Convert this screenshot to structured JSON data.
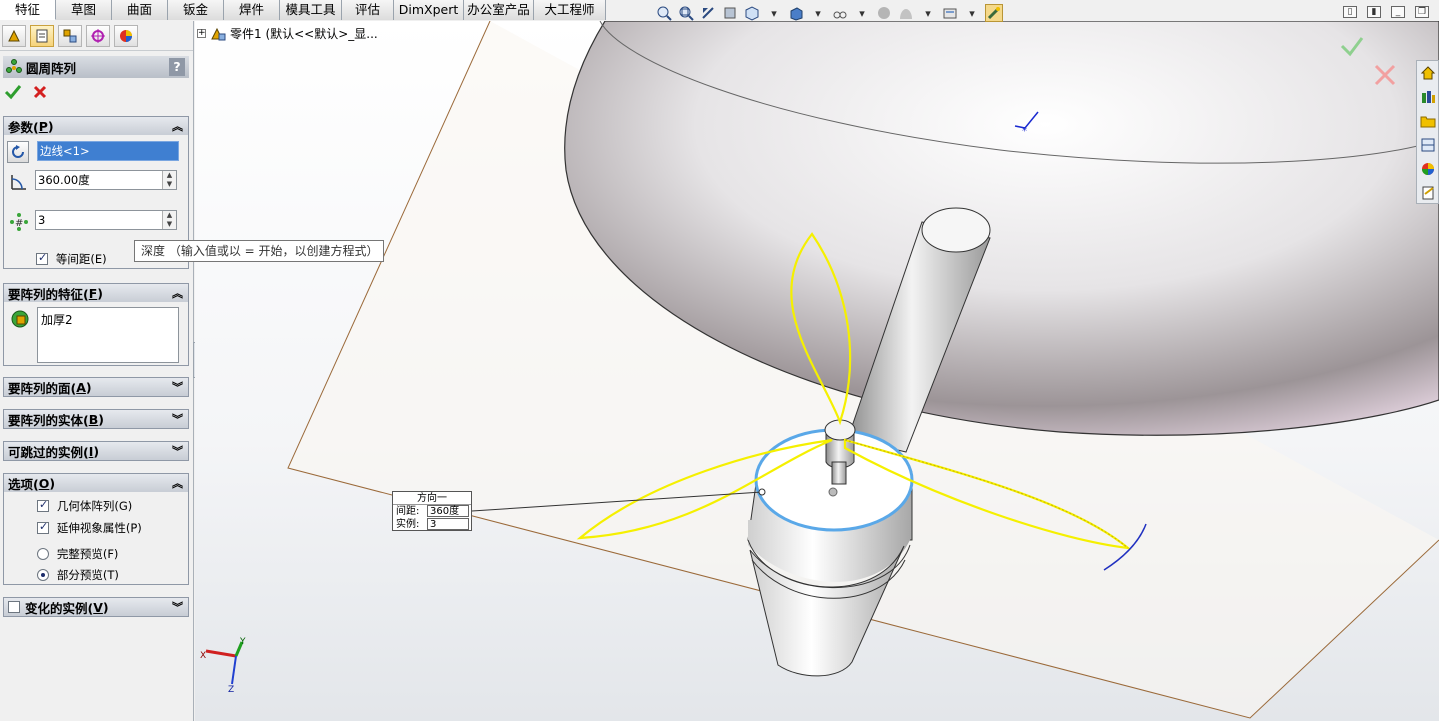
{
  "tabs": [
    {
      "label": "特征",
      "active": true
    },
    {
      "label": "草图"
    },
    {
      "label": "曲面"
    },
    {
      "label": "钣金"
    },
    {
      "label": "焊件"
    },
    {
      "label": "模具工具"
    },
    {
      "label": "评估"
    },
    {
      "label": "DimXpert"
    },
    {
      "label": "办公室产品"
    },
    {
      "label": "大工程师"
    }
  ],
  "panel": {
    "feature_title": "圆周阵列",
    "help": "?",
    "params": {
      "head": "参数(",
      "head_key": "P",
      "head_end": ")",
      "axis_value": "边线<1>",
      "angle_value": "360.00度",
      "count_value": "3",
      "equal_spacing_label": "等间距(E)"
    },
    "features": {
      "head": "要阵列的特征(",
      "head_key": "F",
      "head_end": ")",
      "item": "加厚2"
    },
    "faces": {
      "head": "要阵列的面(",
      "head_key": "A",
      "head_end": ")"
    },
    "bodies": {
      "head": "要阵列的实体(",
      "head_key": "B",
      "head_end": ")"
    },
    "skip": {
      "head": "可跳过的实例(",
      "head_key": "I",
      "head_end": ")"
    },
    "options": {
      "head": "选项(",
      "head_key": "O",
      "head_end": ")",
      "geometry_pattern": "几何体阵列(G)",
      "propagate": "延伸视象属性(P)",
      "full_preview": "完整预览(F)",
      "partial_preview": "部分预览(T)"
    },
    "vary": {
      "head": "变化的实例(",
      "head_key": "V",
      "head_end": ")"
    }
  },
  "tooltip": "深度 （输入值或以 = 开始，以创建方程式）",
  "tree": {
    "label": "零件1 (默认<<默认>_显..."
  },
  "dimension_callout": {
    "title": "方向一",
    "spacing_label": "间距:",
    "spacing_value": "360度",
    "instances_label": "实例:",
    "instances_value": "3"
  },
  "triad": {
    "x": "X",
    "y": "Y",
    "z": "Z"
  },
  "colors": {
    "preview": "#f5f000",
    "selection": "#5aa8e8",
    "accept": "#2e9e2e",
    "cancel": "#d42020"
  }
}
